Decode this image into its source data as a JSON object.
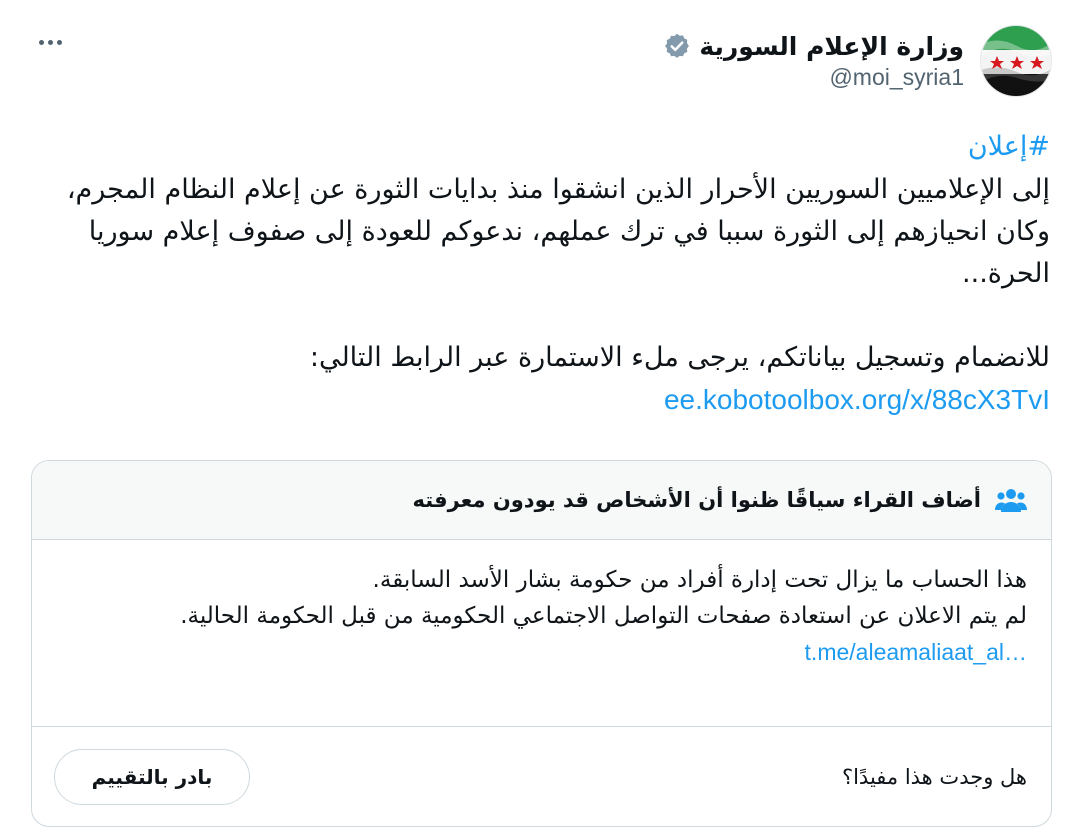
{
  "account": {
    "display_name": "وزارة الإعلام السورية",
    "handle": "@moi_syria1",
    "verified_icon": "verified-badge-icon",
    "avatar_colors": {
      "top": "#2e9e4f",
      "middle": "#ffffff",
      "bottom": "#111111",
      "stars": "#d7191f"
    }
  },
  "tweet": {
    "hashtag": "#إعلان",
    "paragraph1": "إلى الإعلاميين السوريين الأحرار الذين انشقوا منذ بدايات الثورة عن إعلام النظام المجرم، وكان انحيازهم إلى الثورة سببا في ترك عملهم، ندعوكم للعودة إلى صفوف إعلام سوريا الحرة...",
    "paragraph2": "للانضمام وتسجيل بياناتكم، يرجى ملء الاستمارة عبر الرابط التالي:",
    "link": "ee.kobotoolbox.org/x/88cX3TvI"
  },
  "community_note": {
    "title": "أضاف القراء سياقًا ظنوا أن الأشخاص قد يودون معرفته",
    "icon": "people-icon",
    "line1": "هذا الحساب ما يزال تحت إدارة أفراد من حكومة بشار الأسد السابقة.",
    "line2": "لم يتم الاعلان عن استعادة صفحات التواصل الاجتماعي الحكومية من قبل الحكومة الحالية.",
    "link": "t.me/aleamaliaat_al…",
    "helpful_question": "هل وجدت هذا مفيدًا؟",
    "rate_button": "بادر بالتقييم"
  },
  "colors": {
    "accent": "#1d9bf0",
    "muted": "#536471",
    "border": "#cfd9de",
    "header_bg": "#f7f9f9"
  },
  "icons": {
    "more": "more-icon"
  }
}
